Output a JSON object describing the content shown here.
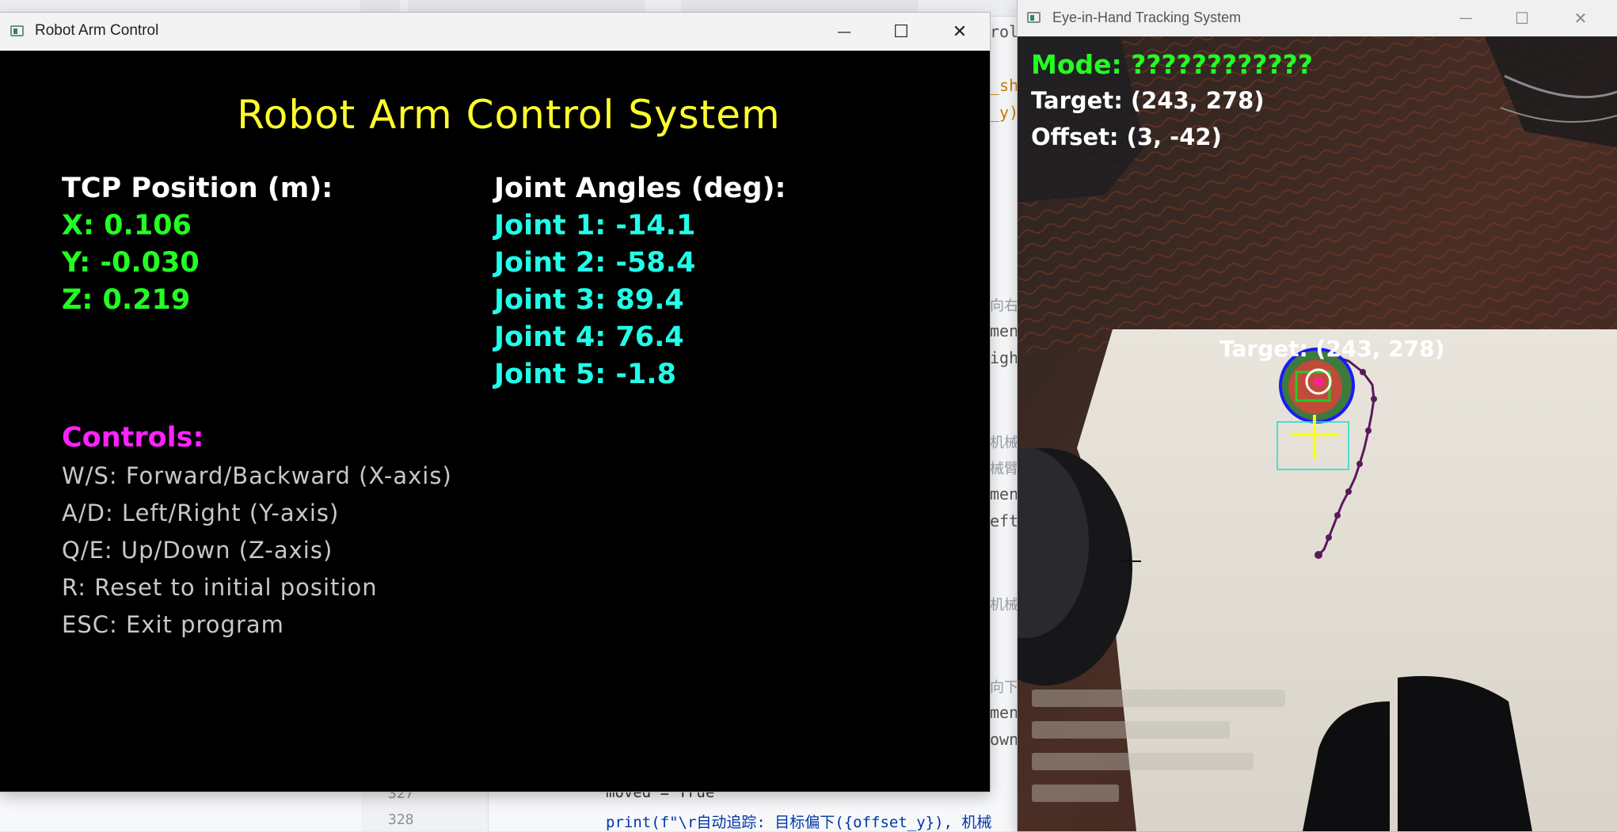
{
  "control_window": {
    "title": "Robot Arm Control",
    "heading": "Robot Arm Control System",
    "tcp": {
      "header": "TCP Position (m):",
      "x": "X: 0.106",
      "y": "Y: -0.030",
      "z": "Z: 0.219"
    },
    "joints": {
      "header": "Joint Angles (deg):",
      "items": [
        "Joint 1: -14.1",
        "Joint 2: -58.4",
        "Joint 3: 89.4",
        "Joint 4: 76.4",
        "Joint 5: -1.8"
      ]
    },
    "controls": {
      "header": "Controls:",
      "items": [
        "W/S: Forward/Backward (X-axis)",
        "A/D: Left/Right (Y-axis)",
        "Q/E: Up/Down (Z-axis)",
        "R: Reset to initial position",
        "ESC: Exit program"
      ]
    },
    "buttons": {
      "minimize": "—",
      "maximize": "☐",
      "close": "✕"
    }
  },
  "tracking_window": {
    "title": "Eye-in-Hand Tracking System",
    "mode": "Mode: ????????????",
    "target": "Target: (243, 278)",
    "offset": "Offset: (3, -42)",
    "target_label": "Target: (243, 278)",
    "buttons": {
      "minimize": "—",
      "maximize": "☐",
      "close": "✕"
    },
    "colors": {
      "mode": "#22ff22",
      "info": "#ffffff",
      "circle": "#1a1aff",
      "crosshair": "#ffff00",
      "trail": "#5a1a5a",
      "box": "#22e0d0"
    }
  },
  "editor": {
    "line_numbers": [
      "327",
      "328"
    ],
    "code_lines": [
      "moved = True",
      "print(f\"\\r自动追踪: 目标偏下({offset_y}), 机械"
    ],
    "fragments": [
      "rol",
      "_sh",
      "_y)",
      "向右",
      "men",
      "igh",
      "机械",
      "械臂",
      "men",
      "eft",
      "机械",
      "向下",
      "men",
      "own"
    ]
  }
}
